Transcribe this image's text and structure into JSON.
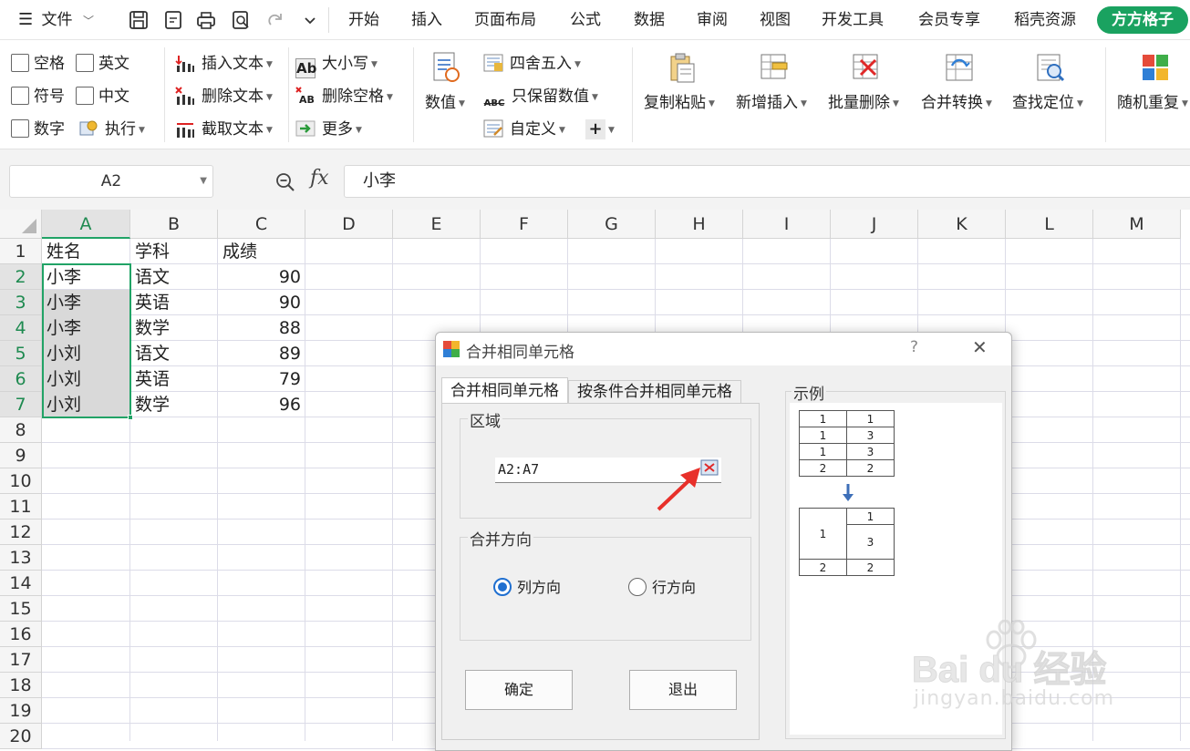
{
  "menubar": {
    "file_label": "文件",
    "tabs": [
      "开始",
      "插入",
      "页面布局",
      "公式",
      "数据",
      "审阅",
      "视图",
      "开发工具",
      "会员专享",
      "稻壳资源"
    ],
    "brand_tab": "方方格子"
  },
  "ribbon": {
    "checkboxes": [
      "空格",
      "英文",
      "符号",
      "中文",
      "数字"
    ],
    "execute_label": "执行",
    "text_group": [
      "插入文本",
      "删除文本",
      "截取文本"
    ],
    "case_group": [
      "大小写",
      "删除空格",
      "更多"
    ],
    "value_label": "数值",
    "number_group": [
      "四舍五入",
      "只保留数值",
      "自定义"
    ],
    "plus_label": "+",
    "big_buttons": [
      "复制粘贴",
      "新增插入",
      "批量删除",
      "合并转换",
      "查找定位",
      "随机重复"
    ]
  },
  "formula_bar": {
    "name_box": "A2",
    "fx_label": "fx",
    "content": "小李"
  },
  "sheet": {
    "columns": [
      "A",
      "B",
      "C",
      "D",
      "E",
      "F",
      "G",
      "H",
      "I",
      "J",
      "K",
      "L",
      "M"
    ],
    "rows": [
      "1",
      "2",
      "3",
      "4",
      "5",
      "6",
      "7",
      "8",
      "9",
      "10",
      "11",
      "12",
      "13",
      "14",
      "15",
      "16",
      "17",
      "18",
      "19",
      "20"
    ],
    "data": [
      [
        "姓名",
        "学科",
        "成绩"
      ],
      [
        "小李",
        "语文",
        "90"
      ],
      [
        "小李",
        "英语",
        "90"
      ],
      [
        "小李",
        "数学",
        "88"
      ],
      [
        "小刘",
        "语文",
        "89"
      ],
      [
        "小刘",
        "英语",
        "79"
      ],
      [
        "小刘",
        "数学",
        "96"
      ]
    ]
  },
  "dialog": {
    "title": "合并相同单元格",
    "help": "?",
    "close": "✕",
    "tab_active": "合并相同单元格",
    "tab_other": "按条件合并相同单元格",
    "region_label": "区域",
    "range_value": "A2:A7",
    "direction_label": "合并方向",
    "radio_col": "列方向",
    "radio_row": "行方向",
    "ok_label": "确定",
    "exit_label": "退出",
    "example_label": "示例",
    "example_before": [
      [
        "1",
        "1"
      ],
      [
        "1",
        "3"
      ],
      [
        "1",
        "3"
      ],
      [
        "2",
        "2"
      ]
    ],
    "example_after_merged": "1",
    "example_after_col2": [
      "1",
      "3"
    ],
    "example_after_last": [
      "2",
      "2"
    ]
  },
  "watermark": {
    "brand": "Bai du 经验",
    "url": "jingyan.baidu.com"
  },
  "colors": {
    "accent_green": "#1aa260",
    "selection_border": "#21a366",
    "arrow_red": "#e8302a"
  }
}
